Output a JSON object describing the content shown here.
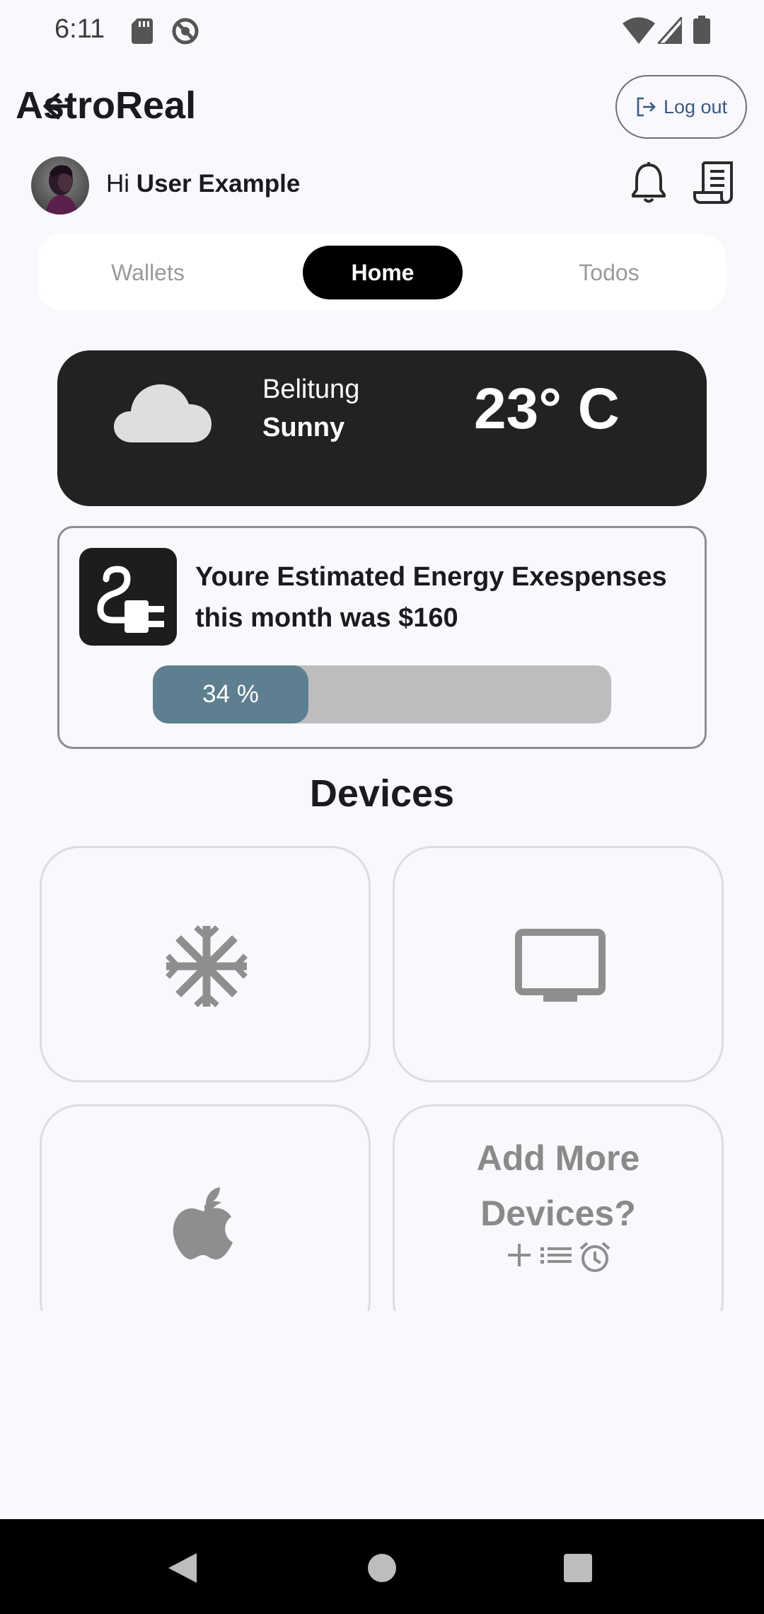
{
  "status_bar": {
    "time": "6:11",
    "icons": [
      "sd-card-icon",
      "blocked-icon",
      "wifi-icon",
      "signal-icon",
      "battery-icon"
    ]
  },
  "app_bar": {
    "title": "AstroReal",
    "back_icon": "back-arrow-icon",
    "logout_label": "Log out",
    "logout_icon": "logout-icon"
  },
  "greeting": {
    "prefix": "Hi",
    "user_name": "User Example",
    "icons": [
      "bell-icon",
      "receipt-icon"
    ]
  },
  "tabs": [
    {
      "label": "Wallets",
      "active": false
    },
    {
      "label": "Home",
      "active": true
    },
    {
      "label": "Todos",
      "active": false
    }
  ],
  "weather": {
    "city": "Belitung",
    "condition": "Sunny",
    "temperature": "23° C",
    "icon": "cloud-icon"
  },
  "energy": {
    "text": "Youre Estimated Energy Exespenses this month was $160",
    "progress_label": "34 %",
    "progress_fraction": 0.34,
    "icon": "plug-icon"
  },
  "devices": {
    "title": "Devices",
    "items": [
      {
        "name": "snowflake-icon"
      },
      {
        "name": "tv-icon"
      },
      {
        "name": "apple-icon"
      }
    ],
    "add_more_label": "Add More Devices?",
    "add_more_icons": [
      "plus-icon",
      "list-icon",
      "alarm-icon"
    ]
  },
  "colors": {
    "background": "#f9f8fd",
    "dark_card": "#222222",
    "progress_fill": "#5e7f8f",
    "progress_track": "#bdbdbd",
    "logout_text": "#3a5a84",
    "icon_gray": "#8e8e8e"
  }
}
